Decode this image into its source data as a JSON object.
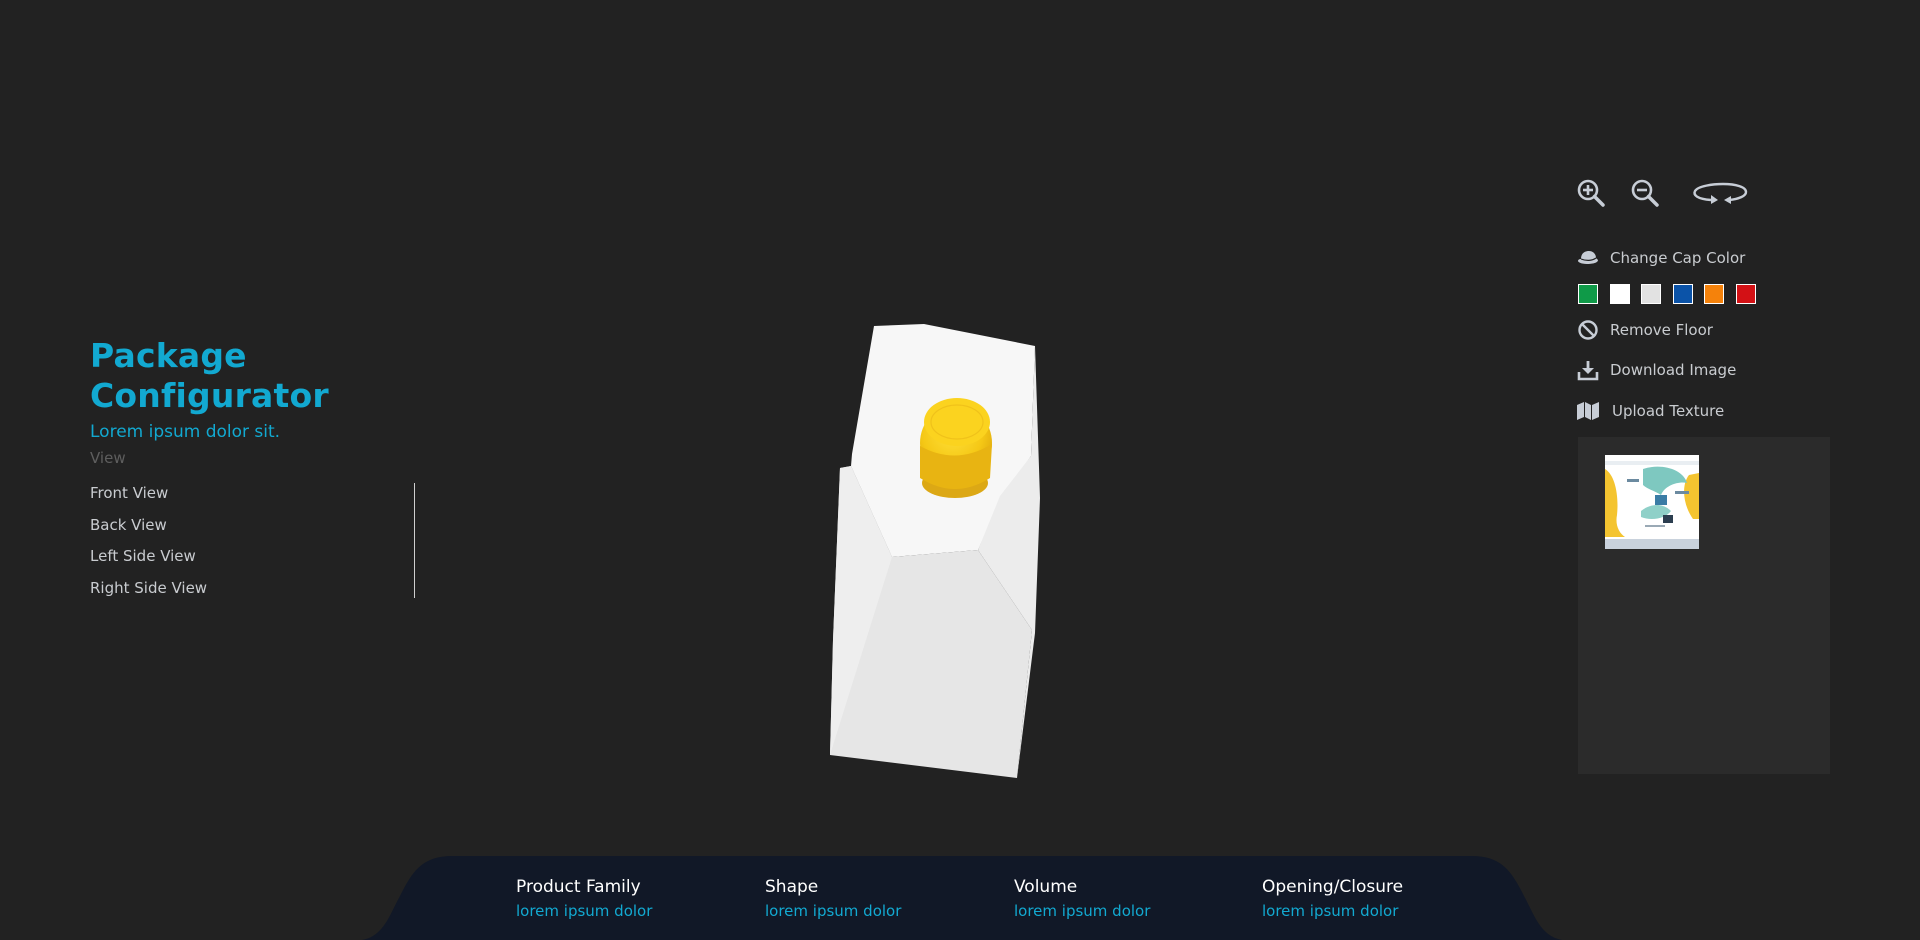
{
  "sidebar": {
    "title": "Package Configurator",
    "subtitle": "Lorem ipsum dolor sit.",
    "view_heading": "View",
    "views": [
      "Front View",
      "Back View",
      "Left Side View",
      "Right Side View"
    ]
  },
  "toolbar": {
    "icons": [
      "zoom-in-icon",
      "zoom-out-icon",
      "rotate-icon"
    ]
  },
  "actions": {
    "change_cap_color": "Change Cap Color",
    "remove_floor": "Remove Floor",
    "download_image": "Download Image",
    "upload_texture": "Upload Texture"
  },
  "cap_colors": [
    "#0f9a48",
    "#ffffff",
    "#e2e2e2",
    "#0b53a8",
    "#f5820b",
    "#d31115"
  ],
  "bottom_bar": {
    "specs": [
      {
        "label": "Product Family",
        "value": "lorem ipsum dolor"
      },
      {
        "label": "Shape",
        "value": "lorem ipsum dolor"
      },
      {
        "label": "Volume",
        "value": "lorem ipsum dolor"
      },
      {
        "label": "Opening/Closure",
        "value": "lorem ipsum dolor"
      }
    ]
  },
  "colors": {
    "background": "#222222",
    "accent": "#12a9d1",
    "bottom_bar": "#111827",
    "texture_panel": "#2b2b2b"
  }
}
